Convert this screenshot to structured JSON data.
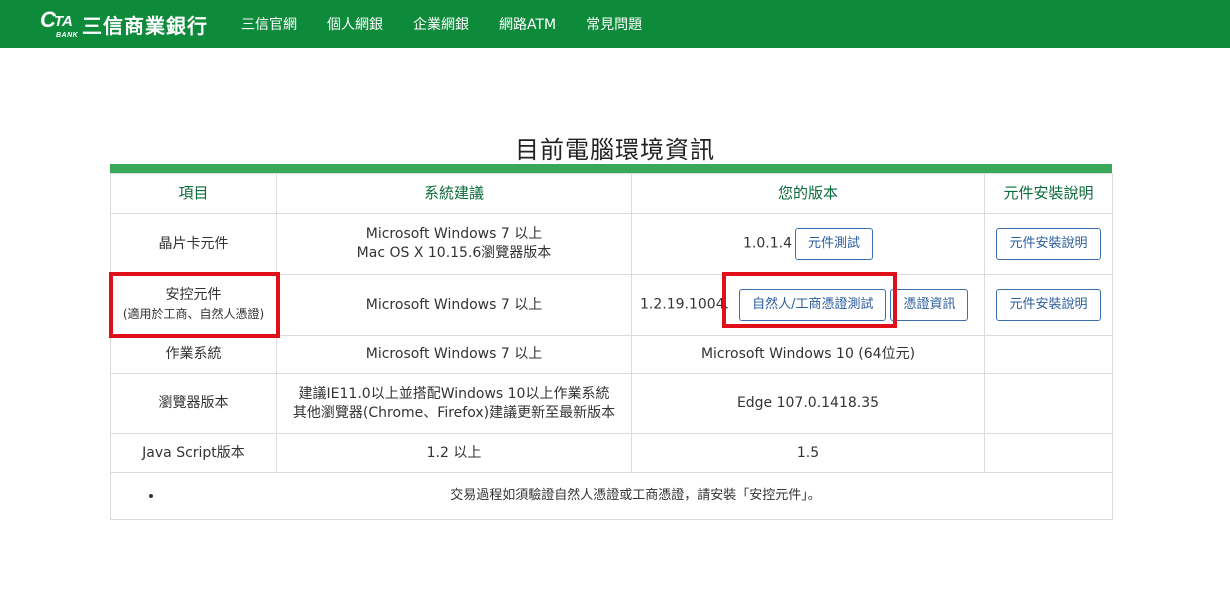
{
  "brand": {
    "logo_mark": "C",
    "logo_ta": "TA",
    "logo_sub": "BANK",
    "name": "三信商業銀行"
  },
  "nav": [
    {
      "label": "三信官網"
    },
    {
      "label": "個人網銀"
    },
    {
      "label": "企業網銀"
    },
    {
      "label": "網路ATM"
    },
    {
      "label": "常見問題"
    }
  ],
  "page_title": "目前電腦環境資訊",
  "table": {
    "headers": [
      "項目",
      "系統建議",
      "您的版本",
      "元件安裝說明"
    ],
    "rows": {
      "chip": {
        "item": "晶片卡元件",
        "rec_line1": "Microsoft Windows 7 以上",
        "rec_line2": "Mac OS X 10.15.6瀏覽器版本",
        "version": "1.0.1.4",
        "test_button": "元件測試",
        "install_button": "元件安裝說明"
      },
      "security": {
        "item": "安控元件",
        "item_note": "(適用於工商、自然人憑證)",
        "rec": "Microsoft Windows 7 以上",
        "version": "1.2.19.1004.",
        "test_button": "自然人/工商憑證測試",
        "cert_button": "憑證資訊",
        "install_button": "元件安裝說明"
      },
      "os": {
        "item": "作業系統",
        "rec": "Microsoft Windows 7 以上",
        "version": "Microsoft Windows 10 (64位元)"
      },
      "browser": {
        "item": "瀏覽器版本",
        "rec_line1": "建議IE11.0以上並搭配Windows 10以上作業系統",
        "rec_line2": "其他瀏覽器(Chrome、Firefox)建議更新至最新版本",
        "version": "Edge 107.0.1418.35"
      },
      "js": {
        "item": "Java Script版本",
        "rec": "1.2 以上",
        "version": "1.5"
      }
    },
    "note": "交易過程如須驗證自然人憑證或工商憑證，請安裝「安控元件」。"
  },
  "colors": {
    "navbar": "#0d8a3a",
    "accent_bar": "#3aa85a",
    "header_text": "#0b6b3a",
    "button_border": "#3a6fb0",
    "highlight": "#e0101a"
  }
}
